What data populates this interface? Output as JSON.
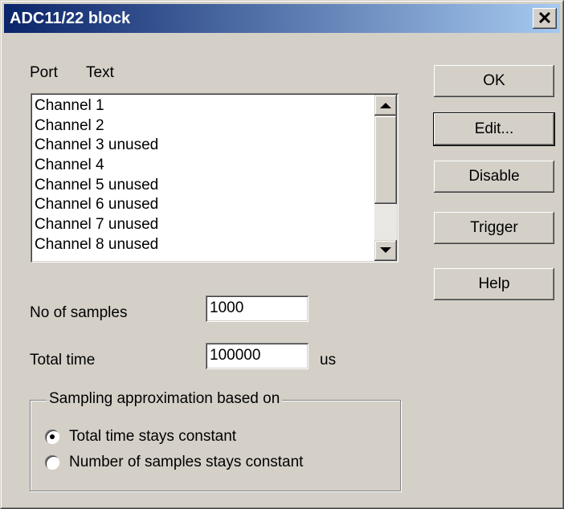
{
  "window": {
    "title": "ADC11/22 block",
    "close_label": "✕"
  },
  "list": {
    "header_port": "Port",
    "header_text": "Text",
    "items": [
      "Channel 1",
      "Channel 2",
      "Channel 3 unused",
      "Channel 4",
      "Channel 5 unused",
      "Channel 6 unused",
      "Channel 7 unused",
      "Channel 8 unused"
    ]
  },
  "buttons": {
    "ok": "OK",
    "edit": "Edit...",
    "disable": "Disable",
    "trigger": "Trigger",
    "help": "Help"
  },
  "samples": {
    "label": "No of samples",
    "value": "1000"
  },
  "total_time": {
    "label": "Total time",
    "value": "100000",
    "unit": "us"
  },
  "sampling": {
    "group_label": "Sampling approximation based on",
    "options": [
      {
        "label": "Total time stays constant",
        "checked": true
      },
      {
        "label": "Number of samples stays constant",
        "checked": false
      }
    ]
  }
}
